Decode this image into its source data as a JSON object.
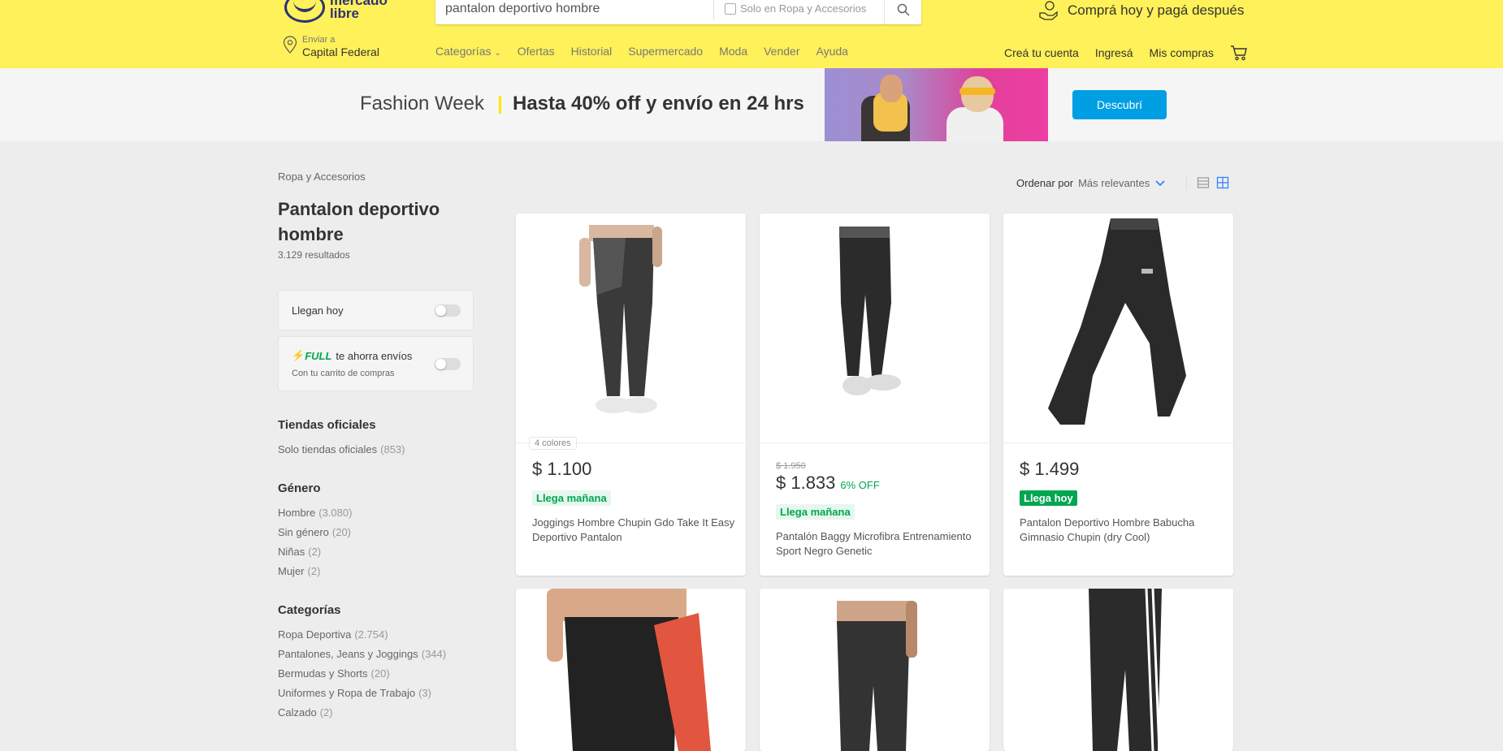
{
  "header": {
    "logo_line1": "mercado",
    "logo_line2": "libre",
    "search_value": "pantalon deportivo hombre",
    "search_filter_label": "Solo en Ropa y Accesorios",
    "promo_text": "Comprá hoy y pagá después",
    "location_label": "Enviar a",
    "location_value": "Capital Federal",
    "nav_items": [
      "Categorías",
      "Ofertas",
      "Historial",
      "Supermercado",
      "Moda",
      "Vender",
      "Ayuda"
    ],
    "account_items": [
      "Creá tu cuenta",
      "Ingresá",
      "Mis compras"
    ]
  },
  "banner": {
    "title": "Fashion Week",
    "offer": "Hasta 40% off y envío en 24 hrs",
    "button": "Descubrí"
  },
  "sidebar": {
    "breadcrumb": "Ropa y Accesorios",
    "title": "Pantalon deportivo hombre",
    "results": "3.129 resultados",
    "filter_today": "Llegan hoy",
    "full_label": "FULL",
    "full_text": "te ahorra envíos",
    "full_sub": "Con tu carrito de compras",
    "sections": [
      {
        "title": "Tiendas oficiales",
        "items": [
          {
            "label": "Solo tiendas oficiales",
            "count": "(853)"
          }
        ]
      },
      {
        "title": "Género",
        "items": [
          {
            "label": "Hombre",
            "count": "(3.080)"
          },
          {
            "label": "Sin género",
            "count": "(20)"
          },
          {
            "label": "Niñas",
            "count": "(2)"
          },
          {
            "label": "Mujer",
            "count": "(2)"
          }
        ]
      },
      {
        "title": "Categorías",
        "items": [
          {
            "label": "Ropa Deportiva",
            "count": "(2.754)"
          },
          {
            "label": "Pantalones, Jeans y Joggings",
            "count": "(344)"
          },
          {
            "label": "Bermudas y Shorts",
            "count": "(20)"
          },
          {
            "label": "Uniformes y Ropa de Trabajo",
            "count": "(3)"
          },
          {
            "label": "Calzado",
            "count": "(2)"
          }
        ]
      }
    ]
  },
  "sort": {
    "label": "Ordenar por",
    "value": "Más relevantes"
  },
  "products": [
    {
      "colors": "4 colores",
      "old_price": "",
      "price": "$ 1.100",
      "discount": "",
      "shipping": "Llega mañana",
      "shipping_style": "light",
      "title": "Joggings Hombre Chupin Gdo Take It Easy Deportivo Pantalon"
    },
    {
      "colors": "",
      "old_price": "$ 1.950",
      "price": "$ 1.833",
      "discount": "6% OFF",
      "shipping": "Llega mañana",
      "shipping_style": "light",
      "title": "Pantalón Baggy Microfibra Entrenamiento Sport Negro Genetic"
    },
    {
      "colors": "",
      "old_price": "",
      "price": "$ 1.499",
      "discount": "",
      "shipping": "Llega hoy",
      "shipping_style": "solid",
      "title": "Pantalon Deportivo Hombre Babucha Gimnasio Chupin (dry Cool)"
    }
  ],
  "colors": {
    "header_yellow": "#fff159",
    "accent_blue": "#3483fa",
    "button_blue": "#009ee3",
    "green": "#00a650"
  }
}
